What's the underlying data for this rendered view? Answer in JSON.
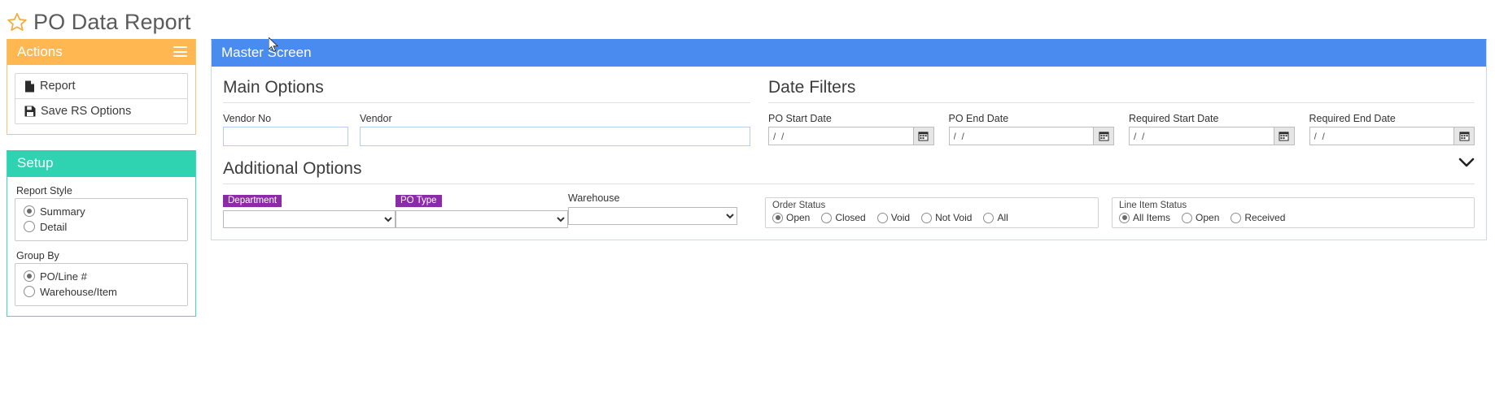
{
  "page": {
    "title": "PO Data Report",
    "star_icon": "star-outline-icon"
  },
  "actions_panel": {
    "header": "Actions",
    "menu_icon": "hamburger-icon",
    "items": [
      {
        "label": "Report",
        "icon": "file-icon"
      },
      {
        "label": "Save RS Options",
        "icon": "save-floppy-icon"
      }
    ]
  },
  "setup_panel": {
    "header": "Setup",
    "groups": [
      {
        "label": "Report Style",
        "options": [
          {
            "label": "Summary",
            "selected": true
          },
          {
            "label": "Detail",
            "selected": false
          }
        ]
      },
      {
        "label": "Group By",
        "options": [
          {
            "label": "PO/Line #",
            "selected": true
          },
          {
            "label": "Warehouse/Item",
            "selected": false
          }
        ]
      }
    ]
  },
  "master": {
    "header": "Master Screen",
    "expander_icon": "chevron-down-icon",
    "main_options": {
      "title": "Main Options",
      "vendor_no": {
        "label": "Vendor No",
        "value": "",
        "placeholder": ""
      },
      "vendor": {
        "label": "Vendor",
        "value": "",
        "placeholder": ""
      }
    },
    "date_filters": {
      "title": "Date Filters",
      "fields": [
        {
          "label": "PO Start Date",
          "value": "/  /",
          "icon": "calendar-icon"
        },
        {
          "label": "PO End Date",
          "value": "/  /",
          "icon": "calendar-icon"
        },
        {
          "label": "Required Start Date",
          "value": "/  /",
          "icon": "calendar-icon"
        },
        {
          "label": "Required End Date",
          "value": "/  /",
          "icon": "calendar-icon"
        }
      ]
    },
    "additional_options": {
      "title": "Additional Options",
      "department": {
        "label": "Department",
        "badge": true,
        "value": "",
        "options": [
          ""
        ]
      },
      "po_type": {
        "label": "PO Type",
        "badge": true,
        "value": "",
        "options": [
          ""
        ]
      },
      "warehouse": {
        "label": "Warehouse",
        "badge": false,
        "value": "",
        "options": [
          ""
        ]
      },
      "order_status": {
        "label": "Order Status",
        "options": [
          {
            "label": "Open",
            "selected": true
          },
          {
            "label": "Closed",
            "selected": false
          },
          {
            "label": "Void",
            "selected": false
          },
          {
            "label": "Not Void",
            "selected": false
          },
          {
            "label": "All",
            "selected": false
          }
        ]
      },
      "line_item_status": {
        "label": "Line Item Status",
        "options": [
          {
            "label": "All Items",
            "selected": true
          },
          {
            "label": "Open",
            "selected": false
          },
          {
            "label": "Received",
            "selected": false
          }
        ]
      }
    }
  },
  "colors": {
    "actions_header": "#ffb751",
    "setup_header": "#2fd3b2",
    "master_header": "#4a8bf0",
    "badge": "#8b2ba8",
    "star": "#f5ab3d"
  }
}
